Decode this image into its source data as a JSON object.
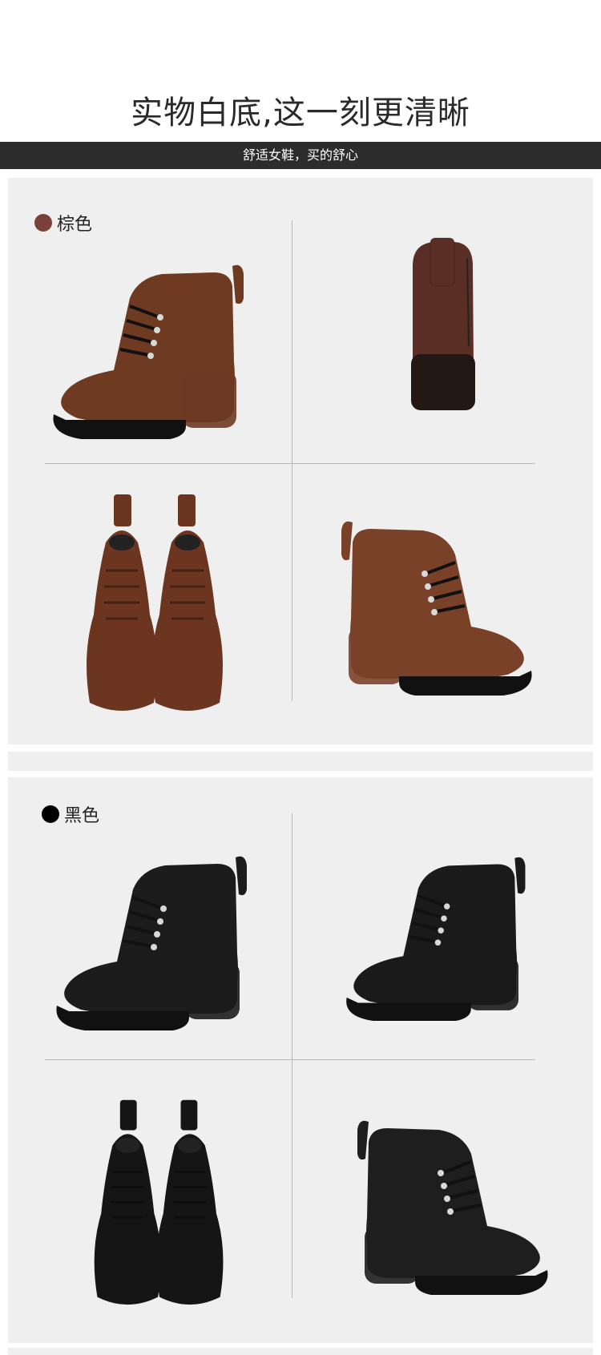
{
  "header": {
    "headline": "实物白底,这一刻更清晰",
    "tagline": "舒适女鞋，买的舒心"
  },
  "colors": {
    "brown_swatch": "#7b3f3c",
    "brown_leather": "#6e3a22",
    "black_swatch": "#000000",
    "black_leather": "#1c1c1c",
    "panel_bg": "#efefef",
    "tag_bar": "#2c2c2c"
  },
  "variants": [
    {
      "label": "棕色",
      "views": [
        "side-view-left",
        "back-view",
        "top-view-pair",
        "side-view-right-zipper"
      ]
    },
    {
      "label": "黑色",
      "views": [
        "side-view-left",
        "three-quarter-view",
        "top-view-pair",
        "side-view-right-zipper"
      ]
    }
  ]
}
